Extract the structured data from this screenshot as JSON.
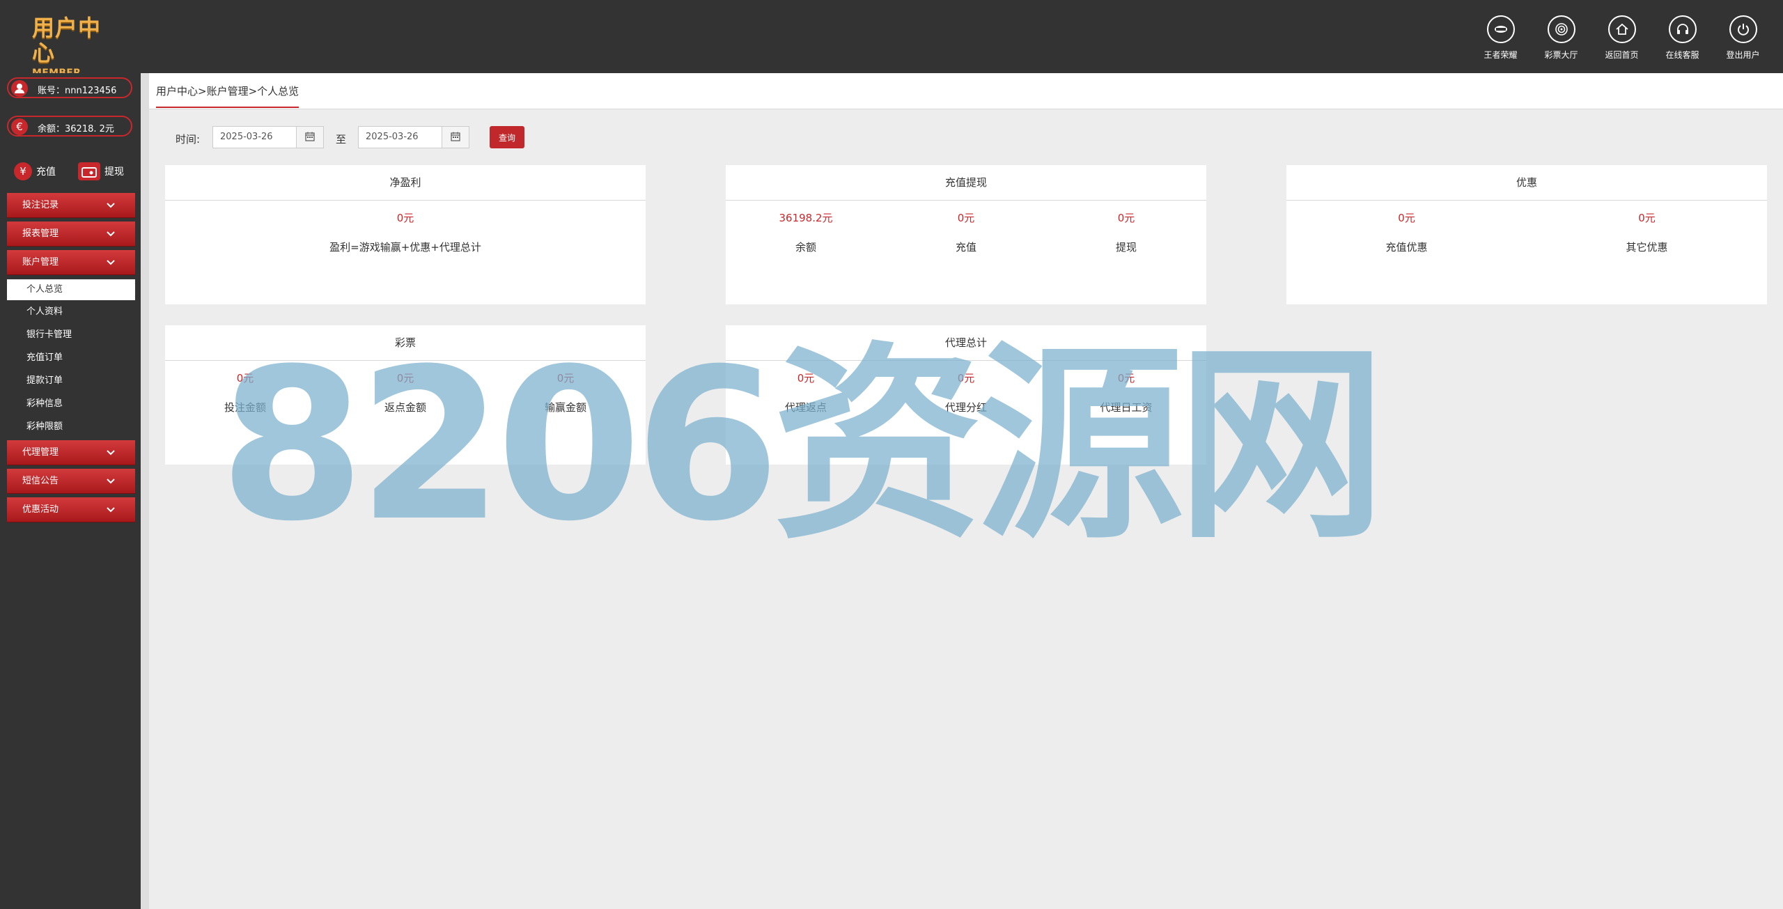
{
  "header": {
    "logo_cn": "用户中心",
    "logo_en": "MEMBER CENTER",
    "nav": [
      {
        "label": "王者荣耀",
        "icon": "honor-of-kings-icon"
      },
      {
        "label": "彩票大厅",
        "icon": "lottery-hall-icon"
      },
      {
        "label": "返回首页",
        "icon": "home-icon"
      },
      {
        "label": "在线客服",
        "icon": "headset-icon"
      },
      {
        "label": "登出用户",
        "icon": "power-icon"
      }
    ]
  },
  "sidebar": {
    "account_label": "账号：",
    "account_value": "nnn123456",
    "balance_label": "余额：",
    "balance_value": "36218. 2元",
    "recharge_label": "充值",
    "withdraw_label": "提现",
    "menus": [
      {
        "label": "投注记录"
      },
      {
        "label": "报表管理"
      },
      {
        "label": "账户管理"
      },
      {
        "label": "代理管理"
      },
      {
        "label": "短信公告"
      },
      {
        "label": "优惠活动"
      }
    ],
    "account_sub": [
      {
        "label": "个人总览"
      },
      {
        "label": "个人资料"
      },
      {
        "label": "银行卡管理"
      },
      {
        "label": "充值订单"
      },
      {
        "label": "提款订单"
      },
      {
        "label": "彩种信息"
      },
      {
        "label": "彩种限额"
      }
    ]
  },
  "breadcrumb": "用户中心>账户管理>个人总览",
  "filter": {
    "time_label": "时间:",
    "start_date": "2025-03-26",
    "to_label": "至",
    "end_date": "2025-03-26",
    "query_label": "查询"
  },
  "cards": {
    "net_profit": {
      "title": "净盈利",
      "cells": [
        {
          "value": "0元",
          "label": "盈利=游戏输赢+优惠+代理总计"
        }
      ]
    },
    "recharge_withdraw": {
      "title": "充值提现",
      "cells": [
        {
          "value": "36198.2元",
          "label": "余额"
        },
        {
          "value": "0元",
          "label": "充值"
        },
        {
          "value": "0元",
          "label": "提现"
        }
      ]
    },
    "promotion": {
      "title": "优惠",
      "cells": [
        {
          "value": "0元",
          "label": "充值优惠"
        },
        {
          "value": "0元",
          "label": "其它优惠"
        }
      ]
    },
    "lottery": {
      "title": "彩票",
      "cells": [
        {
          "value": "0元",
          "label": "投注金额"
        },
        {
          "value": "0元",
          "label": "返点金额"
        },
        {
          "value": "0元",
          "label": "输赢金额"
        }
      ]
    },
    "agent": {
      "title": "代理总计",
      "cells": [
        {
          "value": "0元",
          "label": "代理返点"
        },
        {
          "value": "0元",
          "label": "代理分红"
        },
        {
          "value": "0元",
          "label": "代理日工资"
        }
      ]
    }
  },
  "watermark": "8206资源网",
  "colors": {
    "accent": "#c8282b",
    "dark": "#333333",
    "logo": "#f0b04a"
  }
}
